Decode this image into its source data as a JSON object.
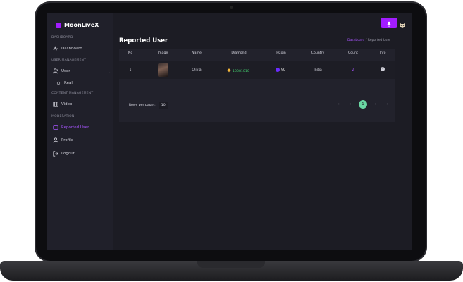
{
  "app": {
    "brand": "MoonLiveX"
  },
  "sidebar": {
    "sections": [
      "DASHBOARD",
      "USER MANAGEMENT",
      "CONTENT MANAGEMENT",
      "MODERATION"
    ],
    "items": [
      {
        "label": "Dashboard",
        "icon": "activity-icon"
      },
      {
        "label": "User",
        "icon": "users-icon"
      },
      {
        "label": "Real",
        "icon": "circle-icon"
      },
      {
        "label": "Video",
        "icon": "film-icon"
      },
      {
        "label": "Reported User",
        "icon": "flag-icon",
        "active": true
      },
      {
        "label": "Profile",
        "icon": "person-icon"
      },
      {
        "label": "Logout",
        "icon": "logout-icon"
      }
    ]
  },
  "header": {
    "bell_icon": "bell-icon",
    "avatar_icon": "avatar-icon"
  },
  "page": {
    "title": "Reported User",
    "breadcrumb": [
      "Dashboard",
      "/",
      "Reported User"
    ]
  },
  "table": {
    "columns": [
      "No",
      "Image",
      "Name",
      "Diamond",
      "RCoin",
      "Country",
      "Count",
      "Info"
    ],
    "rows": [
      {
        "no": "1",
        "name": "Olivia",
        "diamond": "10081010",
        "rcoin": "90",
        "country": "India",
        "count": "2"
      }
    ]
  },
  "pagination": {
    "rows_per_page_label": "Rows per page :",
    "rows_per_page": "10",
    "current_page": "1"
  },
  "colors": {
    "accent": "#a21cff",
    "active_page": "#6ad7a3",
    "diamond_text": "#43c66b"
  }
}
